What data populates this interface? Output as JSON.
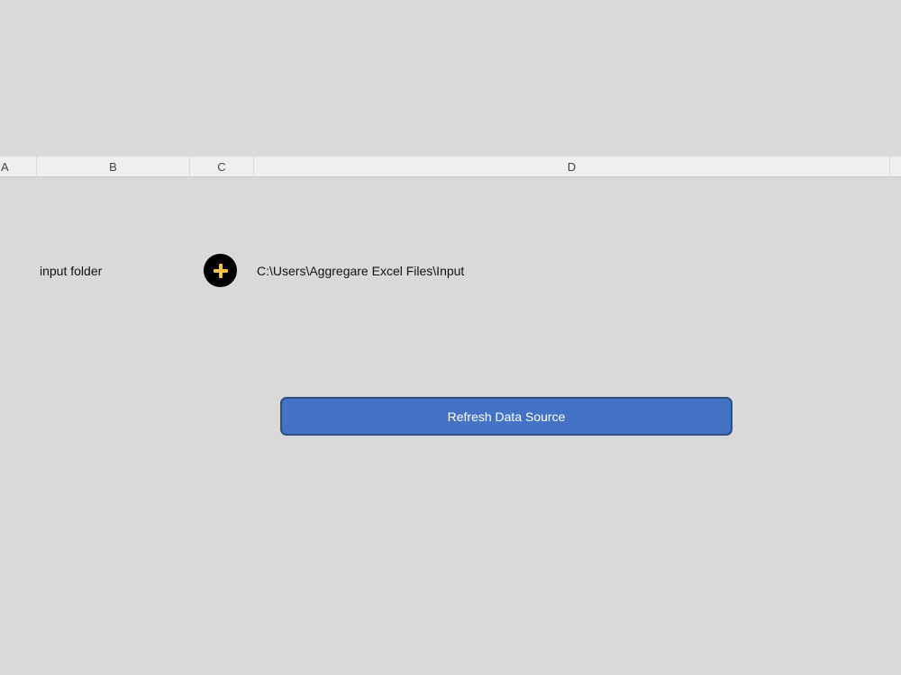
{
  "columns": {
    "a": "A",
    "b": "B",
    "c": "C",
    "d": "D"
  },
  "input_folder": {
    "label": "input folder",
    "path": "C:\\Users\\Aggregare Excel Files\\Input",
    "add_icon": "plus-icon",
    "add_icon_color": "#f5c242"
  },
  "refresh_button": {
    "label": "Refresh Data Source",
    "color": "#4472c4"
  }
}
